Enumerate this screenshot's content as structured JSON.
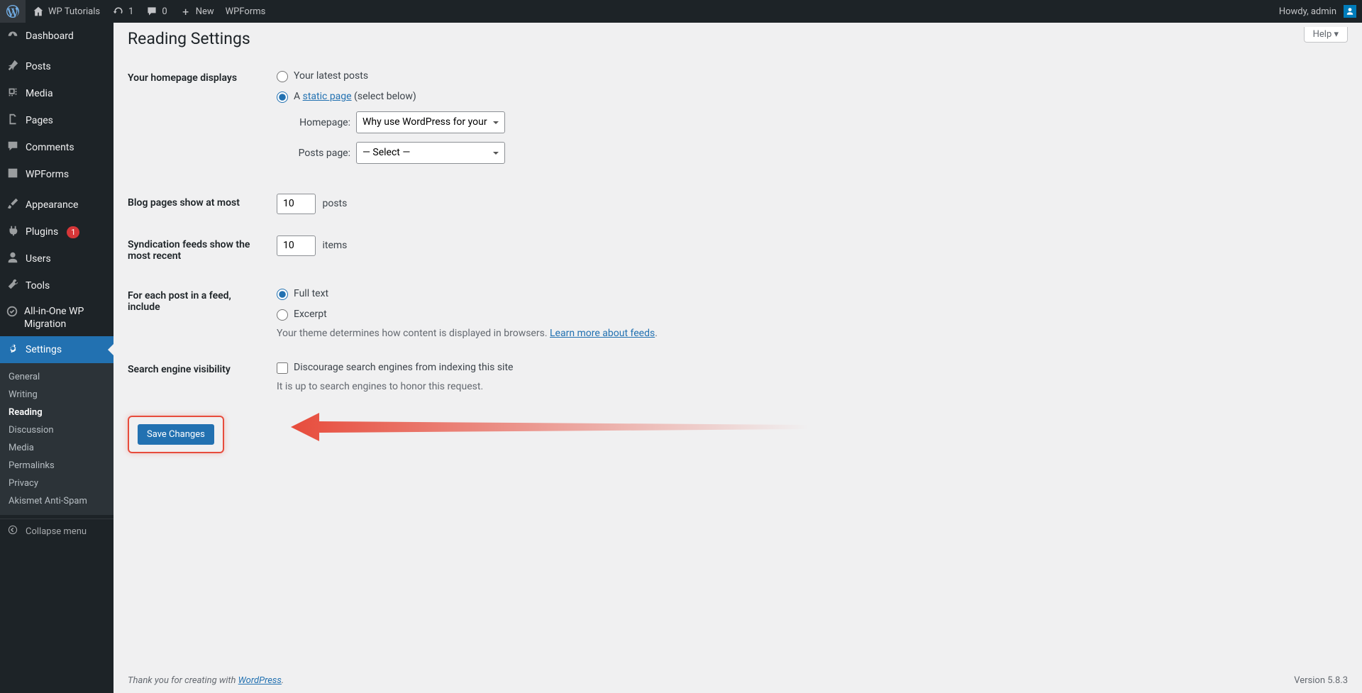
{
  "adminbar": {
    "site": "WP Tutorials",
    "updates": "1",
    "comments": "0",
    "new": "New",
    "wpforms": "WPForms",
    "howdy": "Howdy, admin"
  },
  "sidebar": {
    "dashboard": "Dashboard",
    "posts": "Posts",
    "media": "Media",
    "pages": "Pages",
    "comments": "Comments",
    "wpforms": "WPForms",
    "appearance": "Appearance",
    "plugins": "Plugins",
    "plugins_badge": "1",
    "users": "Users",
    "tools": "Tools",
    "migration": "All-in-One WP Migration",
    "settings": "Settings",
    "collapse": "Collapse menu"
  },
  "submenu": {
    "general": "General",
    "writing": "Writing",
    "reading": "Reading",
    "discussion": "Discussion",
    "media": "Media",
    "permalinks": "Permalinks",
    "privacy": "Privacy",
    "akismet": "Akismet Anti-Spam"
  },
  "page": {
    "help": "Help ▾",
    "title": "Reading Settings"
  },
  "form": {
    "homepage_label": "Your homepage displays",
    "latest_posts": "Your latest posts",
    "static_prefix": "A ",
    "static_link": "static page",
    "static_suffix": " (select below)",
    "homepage_sel_label": "Homepage:",
    "homepage_sel_value": "Why use WordPress for your website?",
    "posts_sel_label": "Posts page:",
    "posts_sel_value": "— Select —",
    "blog_pages_label": "Blog pages show at most",
    "blog_pages_value": "10",
    "blog_pages_unit": "posts",
    "syndication_label": "Syndication feeds show the most recent",
    "syndication_value": "10",
    "syndication_unit": "items",
    "feed_include_label": "For each post in a feed, include",
    "feed_full": "Full text",
    "feed_excerpt": "Excerpt",
    "feed_desc_pre": "Your theme determines how content is displayed in browsers. ",
    "feed_desc_link": "Learn more about feeds",
    "visibility_label": "Search engine visibility",
    "discourage": "Discourage search engines from indexing this site",
    "discourage_desc": "It is up to search engines to honor this request.",
    "save_button": "Save Changes"
  },
  "footer": {
    "thanks_pre": "Thank you for creating with ",
    "thanks_link": "WordPress",
    "version": "Version 5.8.3"
  }
}
